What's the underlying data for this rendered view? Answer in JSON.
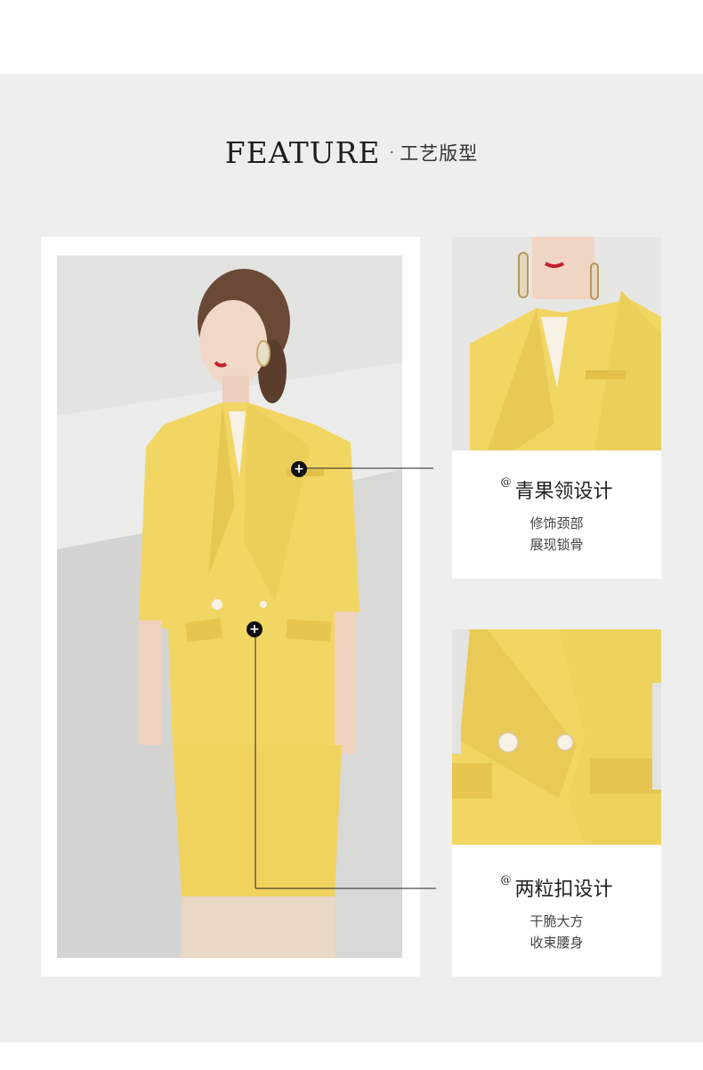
{
  "header": {
    "title_en": "FEATURE",
    "separator": "·",
    "title_cn": "工艺版型"
  },
  "features": [
    {
      "at": "@",
      "title": "青果领设计",
      "lines": [
        "修饰颈部",
        "展现锁骨"
      ]
    },
    {
      "at": "@",
      "title": "两粒扣设计",
      "lines": [
        "干脆大方",
        "收束腰身"
      ]
    }
  ],
  "hotspot_icon": "plus-icon",
  "colors": {
    "panel": "#eeeeee",
    "card": "#ffffff",
    "suit_yellow": "#f2d664",
    "text_dark": "#1f1f1f"
  }
}
